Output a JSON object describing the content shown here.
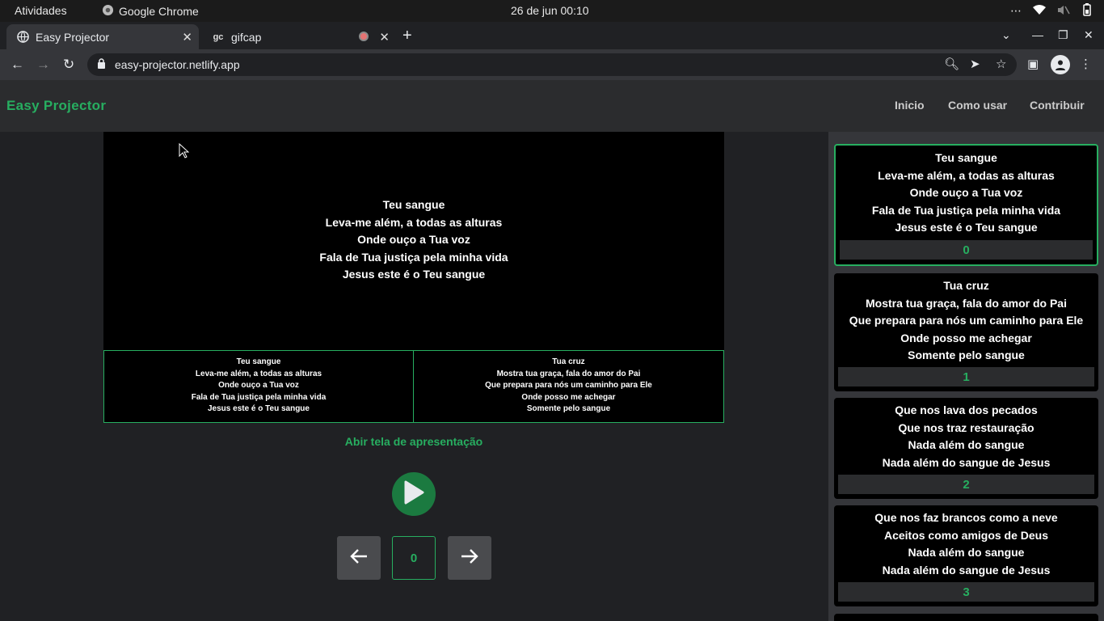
{
  "os": {
    "activities": "Atividades",
    "app_name": "Google Chrome",
    "clock": "26 de jun  00:10"
  },
  "tabs": [
    {
      "title": "Easy Projector",
      "active": true
    },
    {
      "title": "gifcap",
      "active": false
    }
  ],
  "address": {
    "url": "easy-projector.netlify.app"
  },
  "site": {
    "brand": "Easy Projector",
    "nav": [
      "Inicio",
      "Como usar",
      "Contribuir"
    ],
    "open_presentation": "Abir tela de apresentação",
    "counter": "0",
    "accent": "#27ae60"
  },
  "current_slide": [
    "Teu sangue",
    "Leva-me além, a todas as alturas",
    "Onde ouço a Tua voz",
    "Fala de Tua justiça pela minha vida",
    "Jesus este é o Teu sangue"
  ],
  "preview_current": [
    "Teu sangue",
    "Leva-me além, a todas as alturas",
    "Onde ouço a Tua voz",
    "Fala de Tua justiça pela minha vida",
    "Jesus este é o Teu sangue"
  ],
  "preview_next": [
    "Tua cruz",
    "Mostra tua graça, fala do amor do Pai",
    "Que prepara para nós um caminho para Ele",
    "Onde posso me achegar",
    "Somente pelo sangue"
  ],
  "slides": [
    {
      "lines": [
        "Teu sangue",
        "Leva-me além, a todas as alturas",
        "Onde ouço a Tua voz",
        "Fala de Tua justiça pela minha vida",
        "Jesus este é o Teu sangue"
      ],
      "index": "0",
      "selected": true
    },
    {
      "lines": [
        "Tua cruz",
        "Mostra tua graça, fala do amor do Pai",
        "Que prepara para nós um caminho para Ele",
        "Onde posso me achegar",
        "Somente pelo sangue"
      ],
      "index": "1",
      "selected": false
    },
    {
      "lines": [
        "Que nos lava dos pecados",
        "Que nos traz restauração",
        "Nada além do sangue",
        "Nada além do sangue de Jesus"
      ],
      "index": "2",
      "selected": false
    },
    {
      "lines": [
        "Que nos faz brancos como a neve",
        "Aceitos como amigos de Deus",
        "Nada além do sangue",
        "Nada além do sangue de Jesus"
      ],
      "index": "3",
      "selected": false
    }
  ]
}
